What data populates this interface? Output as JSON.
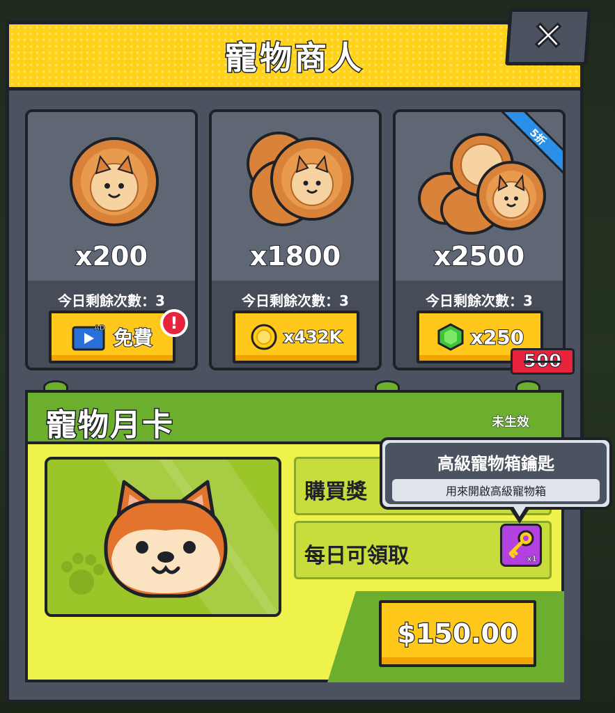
{
  "header": {
    "title": "寵物商人"
  },
  "close": {
    "icon": "close-icon"
  },
  "offers": [
    {
      "amount": "x200",
      "remaining": "今日剩餘次數：3",
      "button_label": "免費",
      "button_icon": "ad-video-icon",
      "icon_badge": "AD",
      "alert": "!"
    },
    {
      "amount": "x1800",
      "remaining": "今日剩餘次數：3",
      "button_label": "x432K",
      "button_icon": "gold-coin-icon"
    },
    {
      "amount": "x2500",
      "remaining": "今日剩餘次數：3",
      "button_label": "x250",
      "button_icon": "green-gem-icon",
      "ribbon": "5折",
      "original_price": "500"
    }
  ],
  "monthly": {
    "title": "寵物月卡",
    "status": "未生效",
    "purchase_reward_label": "購買獎",
    "daily_label": "每日可領取",
    "reward_count": "x1",
    "price": "$150.00"
  },
  "tooltip": {
    "title": "高級寵物箱鑰匙",
    "description": "用來開啟高級寵物箱"
  },
  "colors": {
    "header_yellow": "#ffd21a",
    "panel": "#4b5260",
    "button_yellow": "#ffc81a",
    "monthly_green": "#6cae2e",
    "monthly_yellow": "#eef24a",
    "alert_red": "#e8233c",
    "ribbon_blue": "#2a8fe6",
    "key_purple": "#b341e0"
  }
}
